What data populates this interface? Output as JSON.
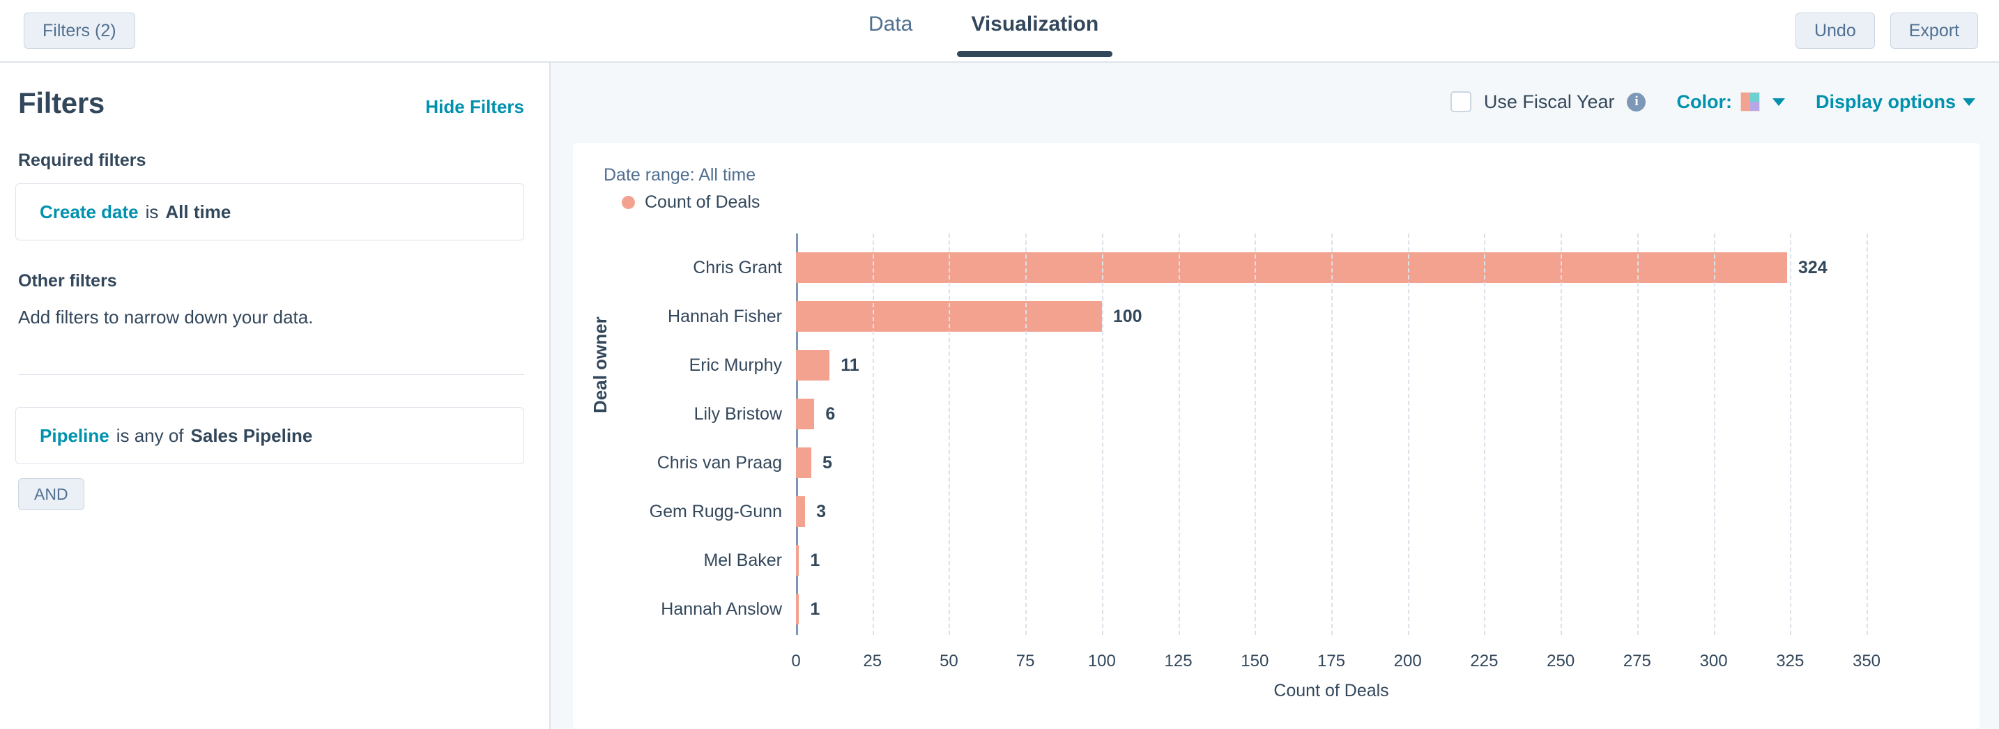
{
  "topbar": {
    "filters_button": "Filters (2)",
    "tabs": [
      {
        "label": "Data",
        "active": false
      },
      {
        "label": "Visualization",
        "active": true
      }
    ],
    "undo_button": "Undo",
    "export_button": "Export"
  },
  "sidebar": {
    "title": "Filters",
    "hide_filters_link": "Hide Filters",
    "required_filters_heading": "Required filters",
    "required_filter": {
      "property": "Create date",
      "operator": "is",
      "value": "All time"
    },
    "other_filters_heading": "Other filters",
    "other_filters_hint": "Add filters to narrow down your data.",
    "other_filter": {
      "property": "Pipeline",
      "operator": "is any of",
      "value": "Sales Pipeline"
    },
    "and_button": "AND"
  },
  "chart_toolbar": {
    "fiscal_year_label": "Use Fiscal Year",
    "fiscal_year_checked": false,
    "info_glyph": "i",
    "color_label": "Color:",
    "color_swatch": [
      "#f2a28f",
      "#6ed0d0",
      "#f2a28f",
      "#b7a6e8"
    ],
    "display_options_label": "Display options"
  },
  "chart_meta": {
    "date_range": "Date range: All time",
    "legend_label": "Count of Deals",
    "legend_color": "#f2a28f"
  },
  "chart_data": {
    "type": "bar",
    "orientation": "horizontal",
    "title": "",
    "xlabel": "Count of Deals",
    "ylabel": "Deal owner",
    "categories": [
      "Chris Grant",
      "Hannah Fisher",
      "Eric Murphy",
      "Lily Bristow",
      "Chris van Praag",
      "Gem Rugg-Gunn",
      "Mel Baker",
      "Hannah Anslow"
    ],
    "values": [
      324,
      100,
      11,
      6,
      5,
      3,
      1,
      1
    ],
    "series": [
      {
        "name": "Count of Deals",
        "color": "#f2a28f",
        "values": [
          324,
          100,
          11,
          6,
          5,
          3,
          1,
          1
        ]
      }
    ],
    "xlim": [
      0,
      350
    ],
    "xticks": [
      0,
      25,
      50,
      75,
      100,
      125,
      150,
      175,
      200,
      225,
      250,
      275,
      300,
      325,
      350
    ],
    "grid": true,
    "legend_position": "top-left",
    "bar_color": "#f2a28f"
  }
}
